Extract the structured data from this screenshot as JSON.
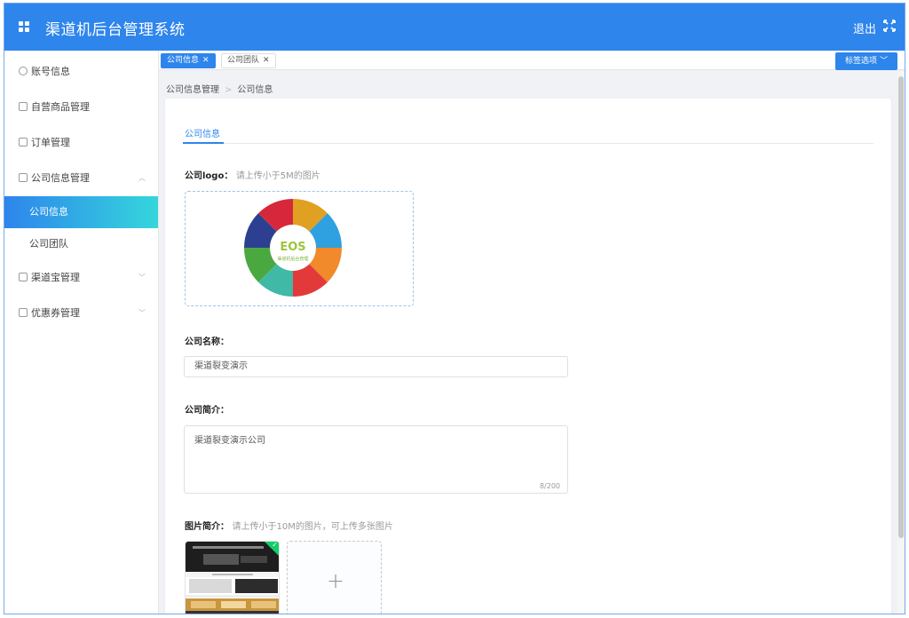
{
  "header": {
    "title": "渠道机后台管理系统",
    "logout_label": "退出"
  },
  "sidebar": {
    "items": [
      {
        "label": "账号信息"
      },
      {
        "label": "自营商品管理"
      },
      {
        "label": "订单管理"
      },
      {
        "label": "公司信息管理",
        "sub": [
          {
            "label": "公司信息",
            "active": true
          },
          {
            "label": "公司团队"
          }
        ]
      },
      {
        "label": "渠道宝管理"
      },
      {
        "label": "优惠券管理"
      }
    ]
  },
  "tabs": [
    {
      "label": "公司信息",
      "active": true
    },
    {
      "label": "公司团队",
      "active": false
    }
  ],
  "tab_options_label": "标签选项",
  "breadcrumb": [
    "公司信息管理",
    "公司信息"
  ],
  "form": {
    "tab_label": "公司信息",
    "logo_label": "公司logo：",
    "logo_hint": "请上传小于5M的图片",
    "logo_text": "EOS",
    "logo_subtext": "渠道机后台管理",
    "name_label": "公司名称：",
    "name_value": "渠道裂变演示",
    "intro_label": "公司简介：",
    "intro_value": "渠道裂变演示公司",
    "intro_counter": "8/200",
    "images_label": "图片简介：",
    "images_hint": "请上传小于10M的图片，可上传多张图片",
    "add_symbol": "+"
  },
  "colors": {
    "primary": "#2e85ec",
    "accent": "#35d6dc",
    "success": "#13ce66"
  }
}
